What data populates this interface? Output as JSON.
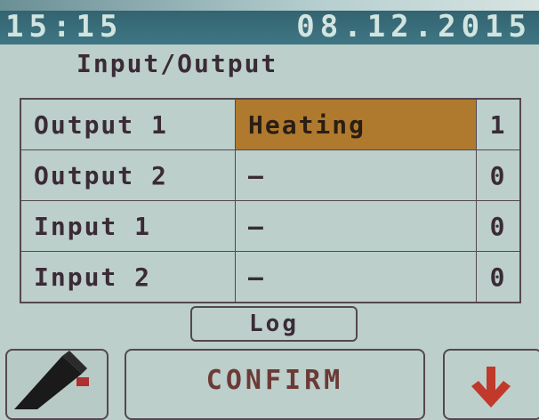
{
  "status": {
    "time": "15:15",
    "date": "08.12.2015"
  },
  "page": {
    "title": "Input/Output"
  },
  "rows": [
    {
      "label": "Output 1",
      "value": "Heating",
      "count": "1",
      "active": true
    },
    {
      "label": "Output 2",
      "value": "—",
      "count": "0",
      "active": false
    },
    {
      "label": "Input 1",
      "value": "—",
      "count": "0",
      "active": false
    },
    {
      "label": "Input 2",
      "value": "—",
      "count": "0",
      "active": false
    }
  ],
  "buttons": {
    "log_label": "Log",
    "confirm_label": "CONFIRM"
  },
  "icons": {
    "left": "edit-pen-icon",
    "right": "arrow-down-icon"
  },
  "colors": {
    "background": "#bccfca",
    "status_bar": "#3f7684",
    "highlight": "#b07a2e",
    "text": "#3a2b36",
    "arrow": "#c0392b"
  }
}
